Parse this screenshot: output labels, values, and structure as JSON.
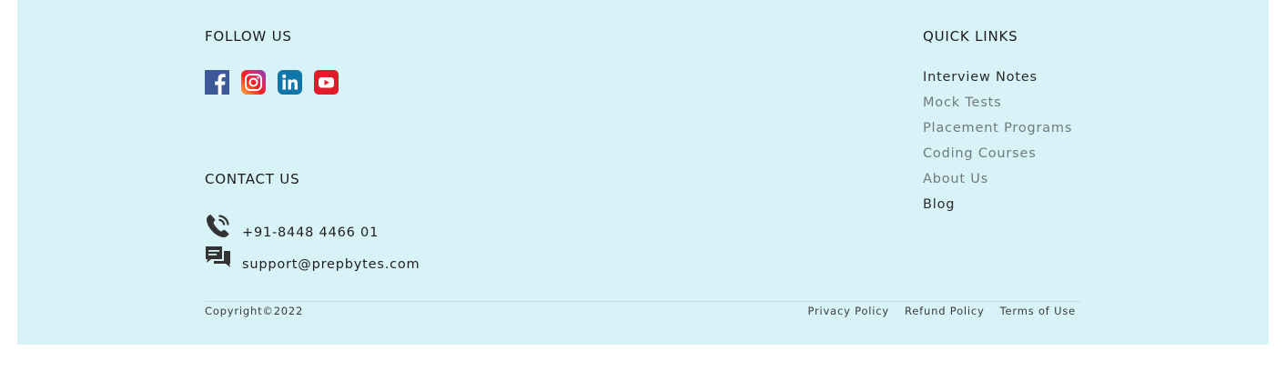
{
  "follow": {
    "heading": "FOLLOW US",
    "icons": [
      "facebook-icon",
      "instagram-icon",
      "linkedin-icon",
      "youtube-icon"
    ]
  },
  "contact": {
    "heading": "CONTACT US",
    "phone": "+91-8448 4466 01",
    "email": "support@prepbytes.com"
  },
  "quick_links": {
    "heading": "QUICK LINKS",
    "items": [
      "Interview Notes",
      "Mock Tests",
      "Placement Programs",
      "Coding Courses",
      "About Us",
      "Blog"
    ]
  },
  "bottom": {
    "copyright": "Copyright©2022",
    "privacy": "Privacy Policy",
    "refund": "Refund Policy",
    "terms": "Terms of Use"
  },
  "colors": {
    "background": "#d8f3f8",
    "facebook": "#3b5998",
    "linkedin": "#0e76a8",
    "youtube": "#e11d2b"
  }
}
